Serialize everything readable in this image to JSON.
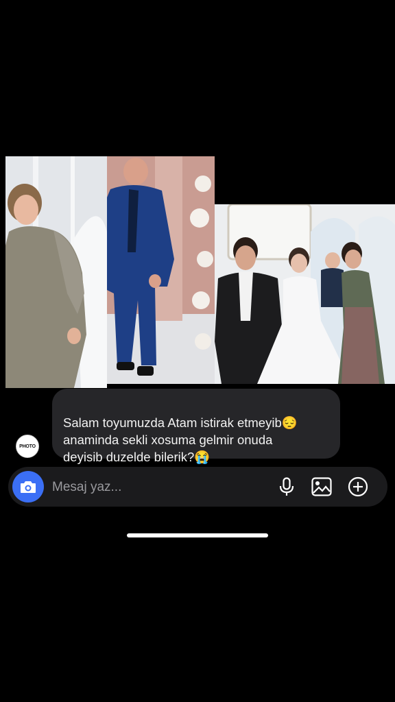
{
  "conversation": {
    "incoming_message": "Salam toyumuzda Atam istirak etmeyib😔\nanaminda sekli xosuma gelmir onuda\ndeyisib duzelde bilerik?😭",
    "sender_avatar_text": "PHOTO"
  },
  "attachments": {
    "photo_count": 3
  },
  "composer": {
    "placeholder": "Mesaj yaz...",
    "camera_icon": "camera-icon",
    "mic_icon": "microphone-icon",
    "gallery_icon": "gallery-icon",
    "add_icon": "plus-circle-icon"
  },
  "colors": {
    "background": "#000000",
    "bubble": "#262629",
    "accent": "#3b6ff5"
  }
}
